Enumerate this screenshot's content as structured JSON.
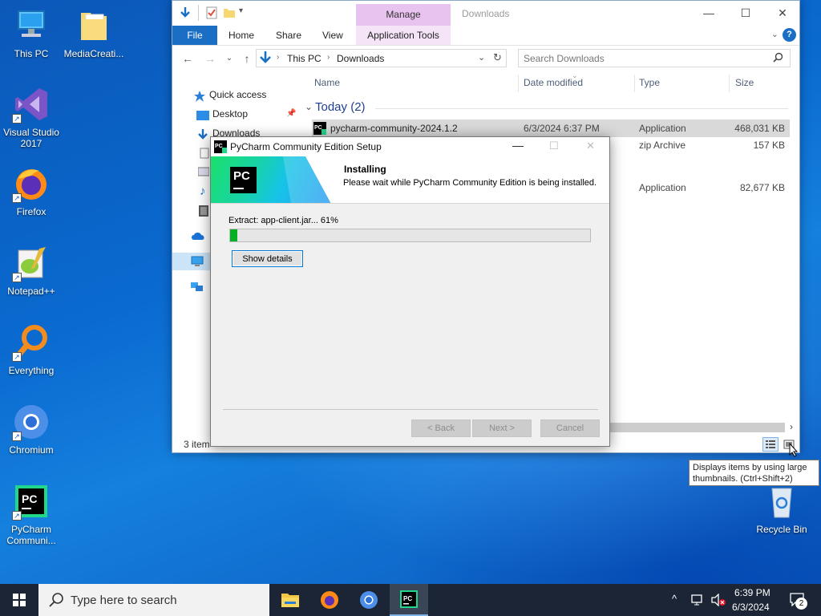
{
  "desktop": {
    "icons": [
      {
        "label": "This PC"
      },
      {
        "label": "MediaCreati..."
      },
      {
        "label": "Visual Studio 2017"
      },
      {
        "label": "Firefox"
      },
      {
        "label": "Notepad++"
      },
      {
        "label": "Everything"
      },
      {
        "label": "Chromium"
      },
      {
        "label": "PyCharm Communi..."
      },
      {
        "label": "Recycle Bin"
      }
    ],
    "pc_logo_text": "PC"
  },
  "explorer": {
    "title": "Downloads",
    "manage_tab": "Manage",
    "ribbon_tabs": [
      "File",
      "Home",
      "Share",
      "View",
      "Application Tools"
    ],
    "help": "?",
    "address": {
      "segments": [
        "This PC",
        "Downloads"
      ]
    },
    "search": {
      "placeholder": "Search Downloads"
    },
    "nav": {
      "quick_access": "Quick access",
      "desktop": "Desktop",
      "downloads": "Downloads"
    },
    "columns": [
      "Name",
      "Date modified",
      "Type",
      "Size"
    ],
    "group": "Today (2)",
    "files": [
      {
        "name": "pycharm-community-2024.1.2",
        "date": "6/3/2024 6:37 PM",
        "type": "Application",
        "size": "468,031 KB"
      },
      {
        "name": "",
        "date": "",
        "type": "zip Archive",
        "size": "157 KB"
      },
      {
        "name": "",
        "date": "",
        "type": "Application",
        "size": "82,677 KB"
      }
    ],
    "status": {
      "items": "3 item"
    }
  },
  "setup": {
    "title": "PyCharm Community Edition Setup",
    "logo_text": "PC",
    "header_title": "Installing",
    "header_subtitle": "Please wait while PyCharm Community Edition is being installed.",
    "extract_text": "Extract: app-client.jar... 61%",
    "progress": 0.02,
    "show_details": "Show details",
    "back": "< Back",
    "next": "Next >",
    "cancel": "Cancel"
  },
  "tooltip": "Displays items by using large thumbnails. (Ctrl+Shift+2)",
  "taskbar": {
    "search_placeholder": "Type here to search",
    "time": "6:39 PM",
    "date": "6/3/2024",
    "notifications": "2",
    "apps": [
      "file-explorer",
      "firefox",
      "chromium",
      "pycharm"
    ]
  },
  "colors": {
    "accent": "#1a6fc4",
    "manage_tab": "#e8c3ef",
    "progress": "#06b025",
    "taskbar": "#1b2535"
  }
}
